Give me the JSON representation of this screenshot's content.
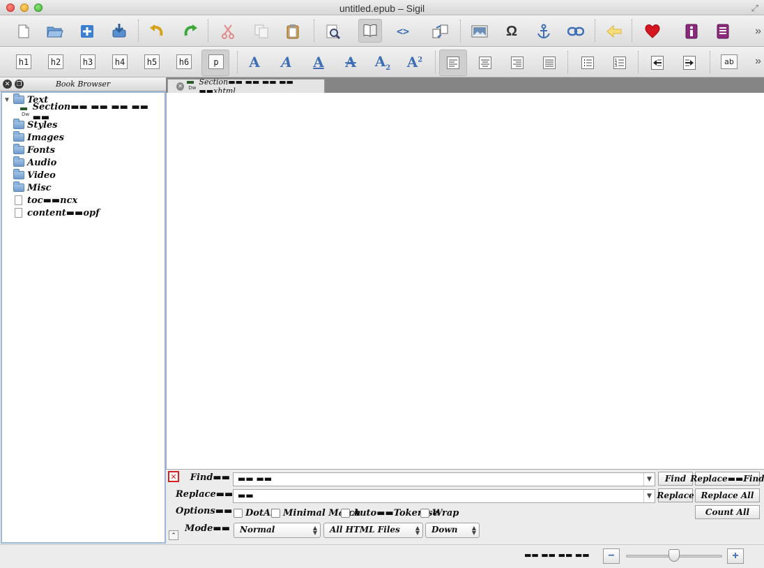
{
  "window": {
    "title": "untitled.epub – Sigil"
  },
  "toolbar1": {
    "buttons": [
      "new-file",
      "open-file",
      "add-file",
      "save-file",
      "undo",
      "redo",
      "cut",
      "copy",
      "paste",
      "find-replace",
      "book-view",
      "code-view",
      "split-merge",
      "insert-image",
      "special-character",
      "anchor",
      "link",
      "go-back",
      "validate",
      "metadata",
      "table-of-contents"
    ]
  },
  "toolbar2": {
    "headings": [
      "h1",
      "h2",
      "h3",
      "h4",
      "h5",
      "h6",
      "p"
    ],
    "format_letter": "A",
    "caseText": "ab"
  },
  "book_browser": {
    "title": "Book Browser",
    "items": [
      {
        "label": "Text",
        "type": "folder",
        "expanded": true
      },
      {
        "label": "Section▬▬ ▬▬ ▬▬ ▬▬ ▬▬",
        "type": "xhtml"
      },
      {
        "label": "Styles",
        "type": "folder"
      },
      {
        "label": "Images",
        "type": "folder"
      },
      {
        "label": "Fonts",
        "type": "folder"
      },
      {
        "label": "Audio",
        "type": "folder"
      },
      {
        "label": "Video",
        "type": "folder"
      },
      {
        "label": "Misc",
        "type": "folder"
      },
      {
        "label": "toc▬▬ncx",
        "type": "file"
      },
      {
        "label": "content▬▬opf",
        "type": "file"
      }
    ]
  },
  "editor": {
    "tab_label": "Section▬▬ ▬▬ ▬▬ ▬▬ ▬▬xhtml",
    "dw_text": "Dw"
  },
  "find_replace": {
    "find_label": "Find▬▬",
    "find_value": "▬▬ ▬▬",
    "replace_label": "Replace▬▬",
    "replace_value": "▬▬",
    "options_label": "Options▬▬",
    "mode_label": "Mode▬▬",
    "options": [
      "DotAll",
      "Minimal Match",
      "Auto▬▬Tokenise",
      "Wrap"
    ],
    "mode_value": "Normal",
    "scope_value": "All HTML Files",
    "direction_value": "Down",
    "buttons": {
      "find": "Find",
      "replace_find": "Replace▬▬Find",
      "replace": "Replace",
      "replace_all": "Replace All",
      "count_all": "Count All"
    }
  },
  "statusbar": {
    "zoom_text": "▬▬ ▬▬ ▬▬ ▬▬",
    "zoom_level": 0.5
  }
}
